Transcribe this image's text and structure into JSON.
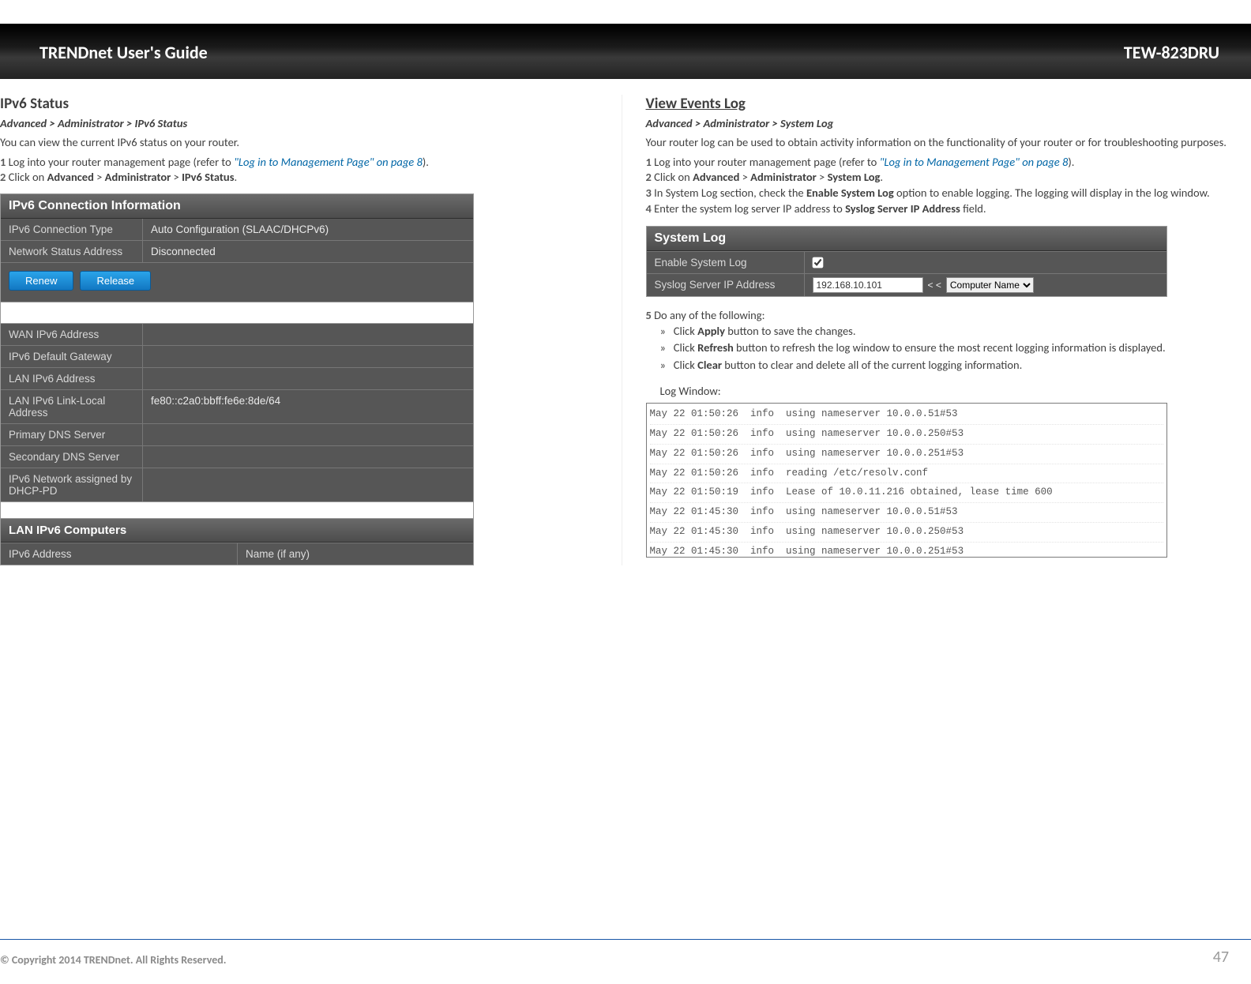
{
  "header": {
    "title": "TRENDnet User's Guide",
    "model": "TEW-823DRU"
  },
  "footer": {
    "copyright": "© Copyright 2014 TRENDnet. All Rights Reserved.",
    "page": "47"
  },
  "ipv6": {
    "title": "IPv6 Status",
    "breadcrumb": "Advanced > Administrator > IPv6 Status",
    "intro": "You can view the current IPv6 status on your router.",
    "step1_pre": "Log into your router management page (refer to ",
    "step1_link": "\"Log in to Management Page\" on page 8",
    "step1_post": ").",
    "step2": "Click on Advanced > Administrator > IPv6 Status.",
    "panel_title": "IPv6 Connection Information",
    "rows1": [
      {
        "key": "IPv6 Connection Type",
        "val": "Auto Configuration (SLAAC/DHCPv6)"
      },
      {
        "key": "Network Status Address",
        "val": "Disconnected"
      }
    ],
    "buttons": {
      "renew": "Renew",
      "release": "Release"
    },
    "rows2": [
      {
        "key": "WAN IPv6 Address",
        "val": ""
      },
      {
        "key": "IPv6 Default Gateway",
        "val": ""
      },
      {
        "key": "LAN IPv6 Address",
        "val": ""
      },
      {
        "key": "LAN IPv6 Link-Local Address",
        "val": "fe80::c2a0:bbff:fe6e:8de/64"
      },
      {
        "key": "Primary DNS Server",
        "val": ""
      },
      {
        "key": "Secondary DNS Server",
        "val": ""
      },
      {
        "key": "IPv6 Network assigned by DHCP-PD",
        "val": ""
      }
    ],
    "lan_title": "LAN IPv6 Computers",
    "lan_cols": {
      "c1": "IPv6 Address",
      "c2": "Name (if any)"
    }
  },
  "events": {
    "title": "View Events Log",
    "breadcrumb": "Advanced > Administrator > System Log",
    "intro": "Your router log can be used to obtain activity information on the functionality of your router or for troubleshooting purposes.",
    "step1_pre": "Log into your router management page (refer to ",
    "step1_link": "\"Log in to Management Page\" on page 8",
    "step1_post": ").",
    "step2": "Click on Advanced > Administrator > System Log.",
    "step3": "In System Log section, check the Enable System Log option to enable logging. The logging will display in the log window.",
    "step4": "Enter the system log server IP address to Syslog Server IP Address field.",
    "panel_title": "System Log",
    "enable_label": "Enable System Log",
    "syslog_label": "Syslog Server IP Address",
    "syslog_ip": "192.168.10.101",
    "syslog_sep": "< <",
    "syslog_select": "Computer Name",
    "step5": "Do any of the following:",
    "b1": "Click Apply button to save the changes.",
    "b2": "Click Refresh button to refresh the log window to ensure the most recent logging information is displayed.",
    "b3": "Click Clear button to clear and delete all of the current logging information.",
    "logwin_label": "Log Window:",
    "log_lines": [
      "May 22 01:50:26  info  using nameserver 10.0.0.51#53",
      "May 22 01:50:26  info  using nameserver 10.0.0.250#53",
      "May 22 01:50:26  info  using nameserver 10.0.0.251#53",
      "May 22 01:50:26  info  reading /etc/resolv.conf",
      "May 22 01:50:19  info  Lease of 10.0.11.216 obtained, lease time 600",
      "May 22 01:45:30  info  using nameserver 10.0.0.51#53",
      "May 22 01:45:30  info  using nameserver 10.0.0.250#53",
      "May 22 01:45:30  info  using nameserver 10.0.0.251#53"
    ]
  }
}
